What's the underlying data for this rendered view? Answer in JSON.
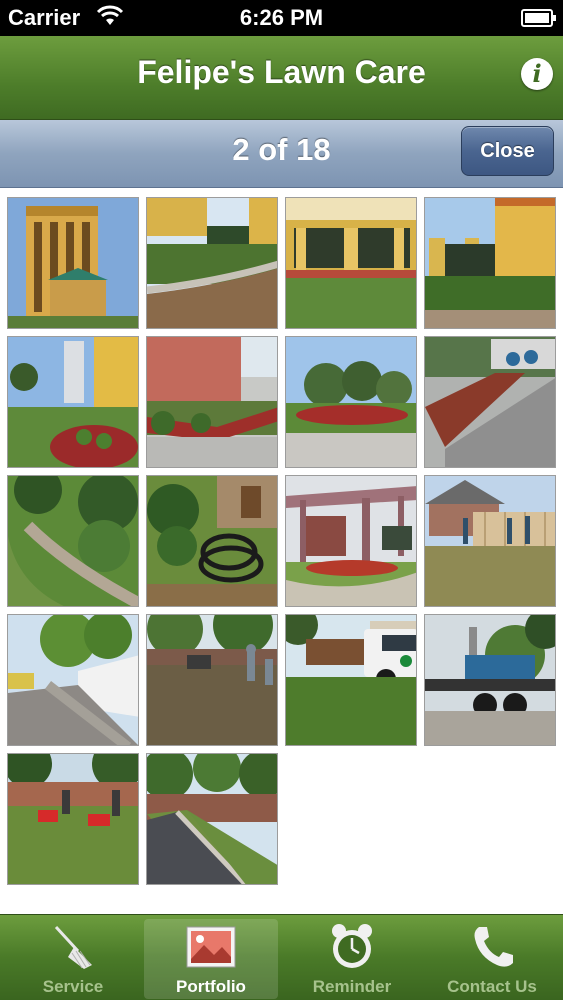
{
  "status_bar": {
    "carrier": "Carrier",
    "time": "6:26 PM"
  },
  "nav": {
    "title": "Felipe's Lawn Care",
    "info_label": "i"
  },
  "toolbar": {
    "counter": "2 of 18",
    "close_label": "Close"
  },
  "photos": [
    {
      "label": "hotel tower with landscaping"
    },
    {
      "label": "curved stone border flower bed"
    },
    {
      "label": "covered entrance with lawn"
    },
    {
      "label": "yellow building with lawn"
    },
    {
      "label": "red mulch flower bed by building"
    },
    {
      "label": "red brick wall with shrubs"
    },
    {
      "label": "landscaped island with trees"
    },
    {
      "label": "crew working near parking area"
    },
    {
      "label": "curved stone border with shrubs"
    },
    {
      "label": "hose and shrubs in yard"
    },
    {
      "label": "pergola over patio"
    },
    {
      "label": "house with wood fence and crew"
    },
    {
      "label": "tree row along white fence"
    },
    {
      "label": "crew mowing under trees"
    },
    {
      "label": "white truck with mowers"
    },
    {
      "label": "trailer loaded with equipment"
    },
    {
      "label": "crew with red mowers by wall"
    },
    {
      "label": "walking path along brick wall"
    }
  ],
  "tabs": [
    {
      "label": "Service",
      "icon": "broom-icon"
    },
    {
      "label": "Portfolio",
      "icon": "picture-icon"
    },
    {
      "label": "Reminder",
      "icon": "alarm-clock-icon"
    },
    {
      "label": "Contact Us",
      "icon": "phone-icon"
    }
  ],
  "colors": {
    "nav_green": "#4d7d2a",
    "toolbar_blue": "#8fa4be",
    "close_blue": "#4a6590"
  }
}
